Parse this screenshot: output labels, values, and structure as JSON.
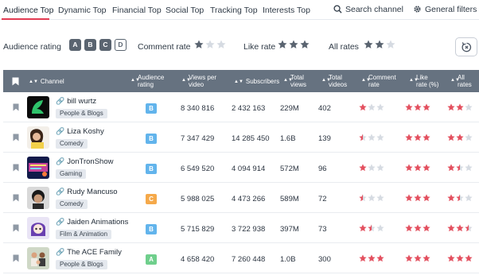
{
  "nav": {
    "tabs": [
      {
        "label": "Audience Top",
        "active": true
      },
      {
        "label": "Dynamic Top"
      },
      {
        "label": "Financial Top"
      },
      {
        "label": "Social Top"
      },
      {
        "label": "Tracking Top"
      },
      {
        "label": "Interests Top"
      }
    ],
    "search_label": "Search channel",
    "filters_label": "General filters"
  },
  "filter_bar": {
    "audience_rating_label": "Audience rating",
    "grades": [
      "A",
      "B",
      "C",
      "D"
    ],
    "comment_rate_label": "Comment rate",
    "comment_rate_stars": 1,
    "like_rate_label": "Like rate",
    "like_rate_stars": 3,
    "all_rates_label": "All rates",
    "all_rates_stars": 2
  },
  "table": {
    "headers": {
      "channel": "Channel",
      "audience_rating": [
        "Audience",
        "rating"
      ],
      "views_per_video": [
        "Views per",
        "video"
      ],
      "subscribers": "Subscribers",
      "total_views": [
        "Total",
        "views"
      ],
      "total_videos": [
        "Total",
        "videos"
      ],
      "comment_rate": [
        "Comment",
        "rate"
      ],
      "like_rate": [
        "Like",
        "rate (%)"
      ],
      "all_rates": [
        "All",
        "rates"
      ]
    },
    "rows": [
      {
        "name": "bill wurtz",
        "category": "People & Blogs",
        "grade": "B",
        "views_per_video": "8 340 816",
        "subscribers": "2 432 163",
        "total_views": "229M",
        "total_videos": "402",
        "comment_rate": 1,
        "like_rate": 3,
        "all_rates": 2
      },
      {
        "name": "Liza Koshy",
        "category": "Comedy",
        "grade": "B",
        "views_per_video": "7 347 429",
        "subscribers": "14 285 450",
        "total_views": "1.6B",
        "total_videos": "139",
        "comment_rate": 0.5,
        "like_rate": 3,
        "all_rates": 2
      },
      {
        "name": "JonTronShow",
        "category": "Gaming",
        "grade": "B",
        "views_per_video": "6 549 520",
        "subscribers": "4 094 914",
        "total_views": "572M",
        "total_videos": "96",
        "comment_rate": 1,
        "like_rate": 3,
        "all_rates": 1.5
      },
      {
        "name": "Rudy Mancuso",
        "category": "Comedy",
        "grade": "C",
        "views_per_video": "5 988 025",
        "subscribers": "4 473 266",
        "total_views": "589M",
        "total_videos": "72",
        "comment_rate": 0.5,
        "like_rate": 3,
        "all_rates": 1.5
      },
      {
        "name": "Jaiden Animations",
        "category": "Film & Animation",
        "grade": "B",
        "views_per_video": "5 715 829",
        "subscribers": "3 722 938",
        "total_views": "397M",
        "total_videos": "73",
        "comment_rate": 1.5,
        "like_rate": 3,
        "all_rates": 2.5
      },
      {
        "name": "The ACE Family",
        "category": "People & Blogs",
        "grade": "A",
        "views_per_video": "4 658 420",
        "subscribers": "7 260 448",
        "total_views": "1.0B",
        "total_videos": "300",
        "comment_rate": 3,
        "like_rate": 3,
        "all_rates": 3
      }
    ]
  },
  "colors": {
    "accent": "#e23b52",
    "star_on": "#e3505f",
    "star_off": "#d6dbe2",
    "filter_star": "#5a6470",
    "grade_A": "#6fcf8c",
    "grade_B": "#62b4ec",
    "grade_C": "#f5a94a",
    "header_bg": "#667280"
  }
}
